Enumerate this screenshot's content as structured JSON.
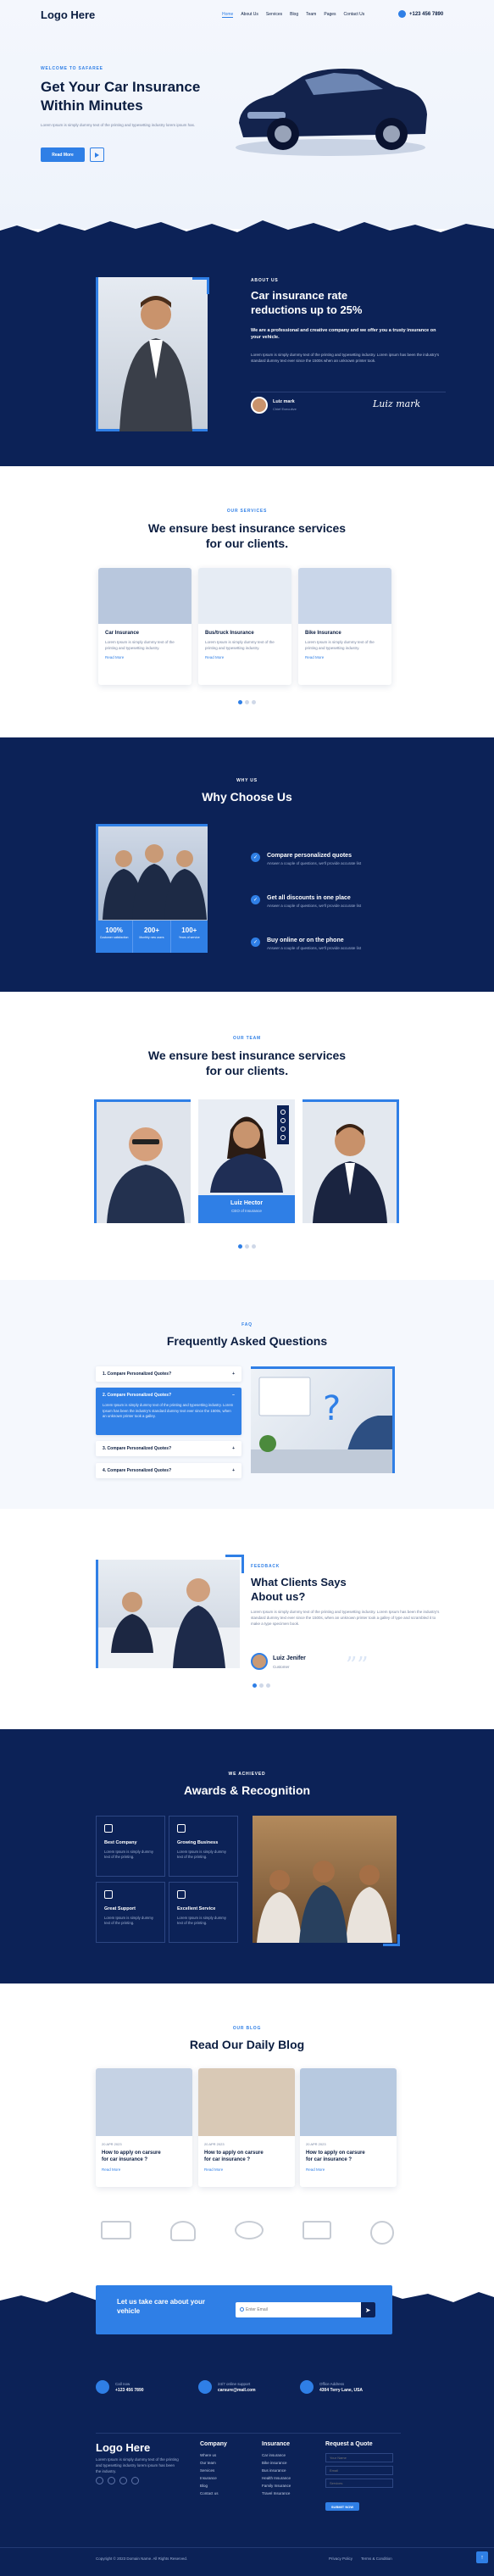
{
  "nav": {
    "logo": "Logo Here",
    "items": [
      "Home",
      "About Us",
      "Services",
      "Blog",
      "Team",
      "Pages",
      "Contact Us"
    ],
    "phone": "+123 456 7890"
  },
  "hero": {
    "kicker": "WELCOME TO SAFAREE",
    "title_line1": "Get Your Car Insurance",
    "title_line2": "Within Minutes",
    "body": "Lorem Ipsum is simply dummy text of the printing and typesetting industry lorem ipsum has.",
    "cta": "Read More"
  },
  "about": {
    "kicker": "ABOUT US",
    "title_line1": "Car insurance rate",
    "title_line2": "reductions up to 25%",
    "lead": "We are a professional and creative company and we offer you a trusty insurance on your vehicle.",
    "body": "Lorem Ipsum is simply dummy text of the printing and typesetting industry. Lorem ipsum has been the industry's standard dummy text ever since the 1500s when an unknown printer took.",
    "name": "Luiz mark",
    "role": "Chief Executive",
    "signature": "Luiz mark"
  },
  "services": {
    "kicker": "OUR SERVICES",
    "title_line1": "We ensure best insurance services",
    "title_line2": "for our clients.",
    "cards": [
      {
        "title": "Car Insurance",
        "body": "Lorem Ipsum is simply dummy text of the printing and typesetting industry.",
        "link": "Read More"
      },
      {
        "title": "Bus/truck Insurance",
        "body": "Lorem Ipsum is simply dummy text of the printing and typesetting industry.",
        "link": "Read More"
      },
      {
        "title": "Bike Insurance",
        "body": "Lorem Ipsum is simply dummy text of the printing and typesetting industry.",
        "link": "Read More"
      }
    ]
  },
  "why": {
    "kicker": "WHY US",
    "title": "Why Choose Us",
    "stats": [
      {
        "value": "100%",
        "label": "Customer satisfaction"
      },
      {
        "value": "200+",
        "label": "Monthly new users"
      },
      {
        "value": "100+",
        "label": "Years of service"
      }
    ],
    "items": [
      {
        "title": "Compare personalized quotes",
        "body": "Answer a couple of questions, we'll provide accurate list"
      },
      {
        "title": "Get all discounts in one place",
        "body": "Answer a couple of questions, we'll provide accurate list"
      },
      {
        "title": "Buy online or on the phone",
        "body": "Answer a couple of questions, we'll provide accurate list"
      }
    ]
  },
  "team": {
    "kicker": "OUR TEAM",
    "title_line1": "We ensure best insurance services",
    "title_line2": "for our clients.",
    "featured_name": "Luiz Hector",
    "featured_role": "CEO of Insurance"
  },
  "faq": {
    "kicker": "FAQ",
    "title": "Frequently Asked Questions",
    "items": [
      "1. Compare Personalized Quotes?",
      "2. Compare Personalized Quotes?",
      "3. Compare Personalized Quotes?",
      "4. Compare Personalized Quotes?"
    ],
    "open_body": "Lorem Ipsum is simply dummy text of the printing and typesetting industry. Lorem Ipsum has been the industry's standard dummy text ever since the 1500s, when an unknown printer took a galley."
  },
  "testimonial": {
    "kicker": "FEEDBACK",
    "title_line1": "What Clients Says",
    "title_line2": "About us?",
    "body": "Lorem Ipsum is simply dummy text of the printing and typesetting industry. Lorem Ipsum has been the industry's standard dummy text ever since the 1500s, when an unknown printer took a galley of type and scrambled it to make a type specimen book.",
    "name": "Luiz Jenifer",
    "role": "Customer"
  },
  "awards": {
    "kicker": "WE ACHIEVED",
    "title": "Awards & Recognition",
    "items": [
      {
        "title": "Best Company",
        "body": "Lorem Ipsum is simply dummy text of the printing."
      },
      {
        "title": "Growing Business",
        "body": "Lorem Ipsum is simply dummy text of the printing."
      },
      {
        "title": "Great Support",
        "body": "Lorem Ipsum is simply dummy text of the printing."
      },
      {
        "title": "Excellent Service",
        "body": "Lorem Ipsum is simply dummy text of the printing."
      }
    ]
  },
  "blog": {
    "kicker": "OUR BLOG",
    "title": "Read Our Daily Blog",
    "posts": [
      {
        "date": "20 APR 2023",
        "title_line1": "How to apply on carsure",
        "title_line2": "for car insurance ?",
        "link": "Read More"
      },
      {
        "date": "20 APR 2023",
        "title_line1": "How to apply on carsure",
        "title_line2": "for car insurance ?",
        "link": "Read More"
      },
      {
        "date": "20 APR 2023",
        "title_line1": "How to apply on carsure",
        "title_line2": "for car insurance ?",
        "link": "Read More"
      }
    ]
  },
  "cta": {
    "title_line1": "Let us take care about your",
    "title_line2": "vehicle",
    "placeholder": "Enter Email"
  },
  "contact": [
    {
      "label": "Call now",
      "value": "+123 456 7890"
    },
    {
      "label": "24/7 online support",
      "value": "carsure@mail.com"
    },
    {
      "label": "Office Address",
      "value": "4304 Terry Lane, USA"
    }
  ],
  "footer": {
    "logo": "Logo Here",
    "about": "Lorem Ipsum is simply dummy text of the printing and typesetting industry lorem ipsum has been the industry.",
    "company_title": "Company",
    "company": [
      "Where us",
      "Our team",
      "Services",
      "Insurance",
      "Blog",
      "Contact us"
    ],
    "insurance_title": "Insurance",
    "insurance": [
      "Car insurance",
      "Bike insurance",
      "Bus insurance",
      "Health Insurance",
      "Family Insurance",
      "Travel Insurance"
    ],
    "quote_title": "Request a Quote",
    "quote_fields": [
      "Your Name",
      "Email",
      "Services"
    ],
    "quote_btn": "SUBMIT NOW",
    "copyright": "Copyright © 2023 Domain Name. All Rights Reserved.",
    "links": [
      "Privacy Policy",
      "Terms & Condition"
    ]
  },
  "colors": {
    "navy": "#0c2257",
    "accent": "#2f7fe6"
  }
}
